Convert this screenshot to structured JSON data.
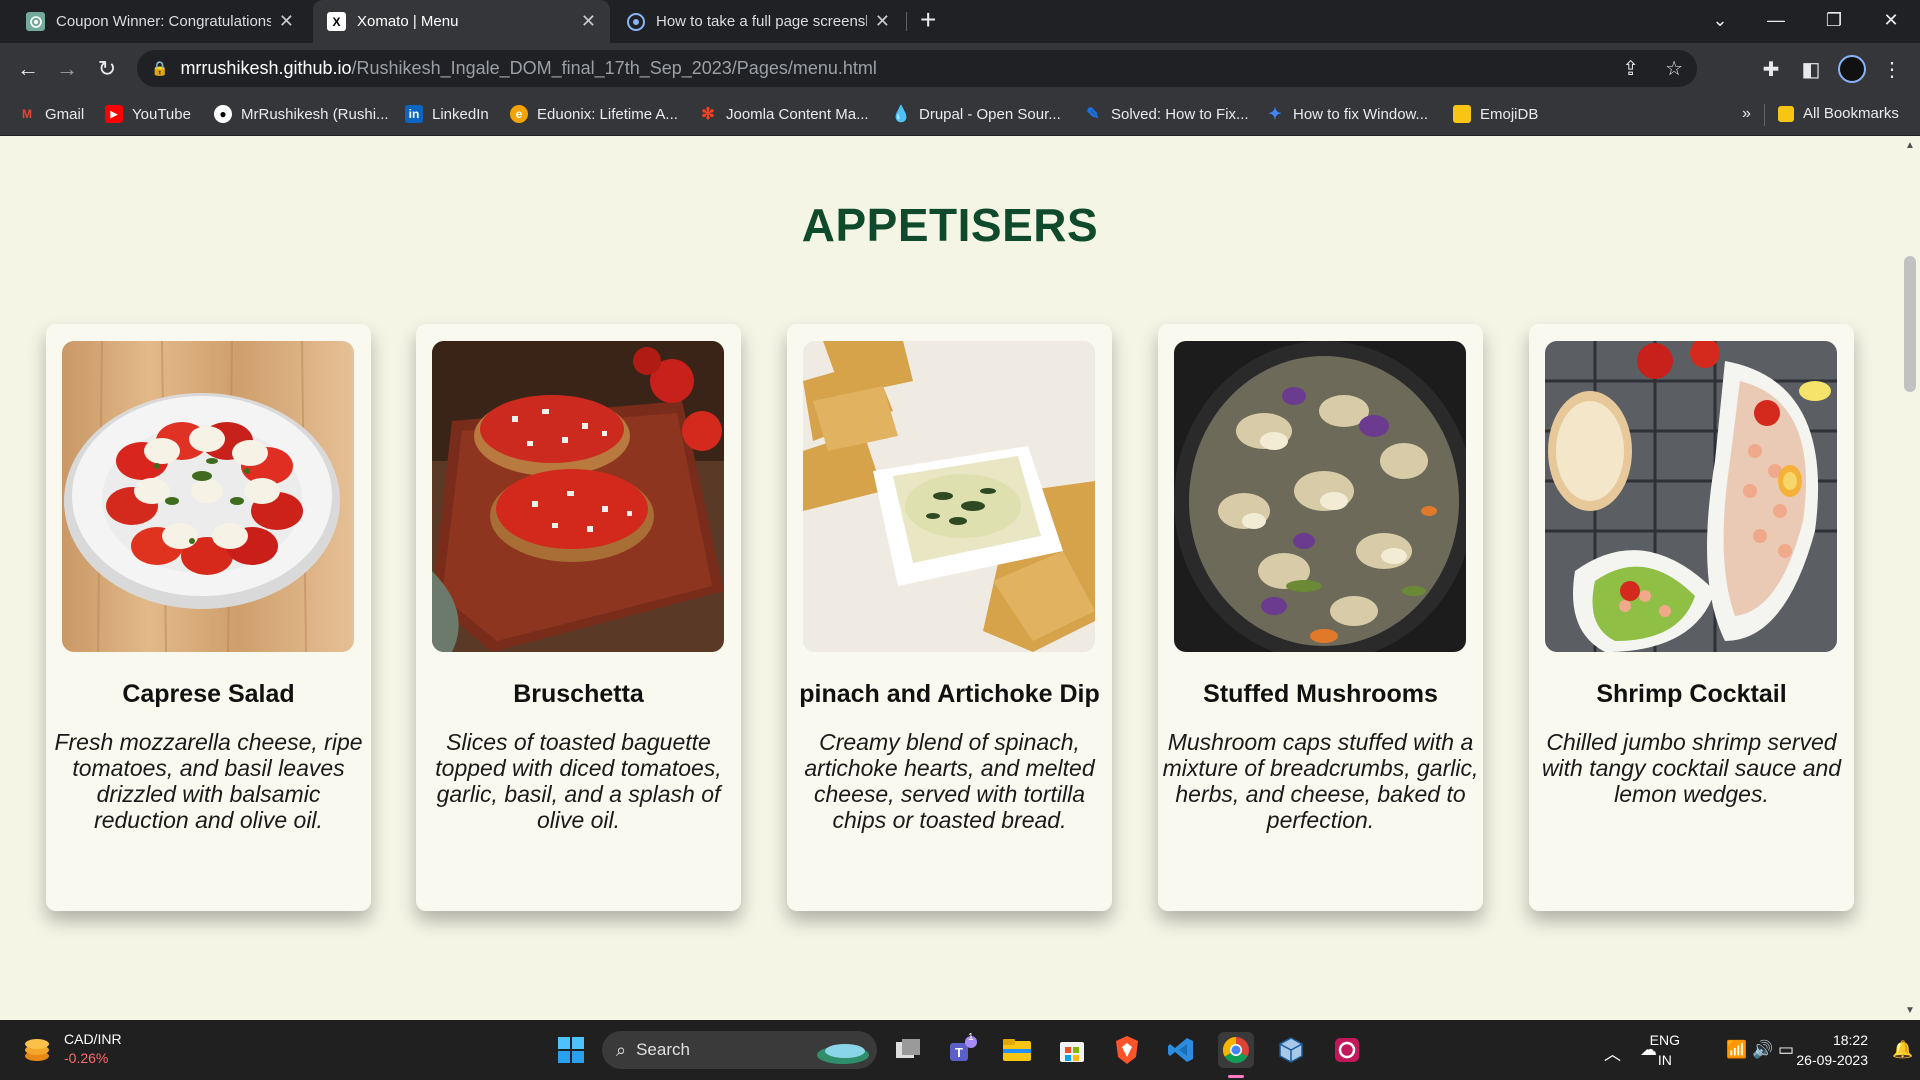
{
  "browser": {
    "tabs": [
      {
        "title": "Coupon Winner: Congratulations",
        "icon": "openai-icon",
        "active": false
      },
      {
        "title": "Xomato | Menu",
        "icon": "xomato-icon",
        "active": true
      },
      {
        "title": "How to take a full page screenshot",
        "icon": "chrome-icon",
        "active": false
      }
    ],
    "url_host": "mrrushikesh.github.io",
    "url_path": "/Rushikesh_Ingale_DOM_final_17th_Sep_2023/Pages/menu.html",
    "bookmarks": [
      {
        "label": "Gmail",
        "icon": "gmail-icon",
        "color": "#ea4335"
      },
      {
        "label": "YouTube",
        "icon": "youtube-icon",
        "color": "#ff0000"
      },
      {
        "label": "MrRushikesh (Rushi...",
        "icon": "github-icon",
        "color": "#ffffff"
      },
      {
        "label": "LinkedIn",
        "icon": "linkedin-icon",
        "color": "#0a66c2"
      },
      {
        "label": "Eduonix: Lifetime A...",
        "icon": "eduonix-icon",
        "color": "#f4a300"
      },
      {
        "label": "Joomla Content Ma...",
        "icon": "joomla-icon",
        "color": "#f44321"
      },
      {
        "label": "Drupal - Open Sour...",
        "icon": "drupal-icon",
        "color": "#0678be"
      },
      {
        "label": "Solved: How to Fix...",
        "icon": "solved-icon",
        "color": "#1a73e8"
      },
      {
        "label": "How to fix Window...",
        "icon": "sparkle-icon",
        "color": "#4285f4"
      },
      {
        "label": "EmojiDB",
        "icon": "folder-icon",
        "color": "#f9c513"
      }
    ],
    "overflow_label": "»",
    "all_bookmarks": "All Bookmarks"
  },
  "page": {
    "section_title": "APPETISERS",
    "colors": {
      "background": "#f5f5e6",
      "title": "#0e4a2b",
      "card": "#f9f9ef"
    },
    "items": [
      {
        "name": "Caprese Salad",
        "description": "Fresh mozzarella cheese, ripe tomatoes, and basil leaves drizzled with balsamic reduction and olive oil."
      },
      {
        "name": "Bruschetta",
        "description": "Slices of toasted baguette topped with diced tomatoes, garlic, basil, and a splash of olive oil."
      },
      {
        "name": "pinach and Artichoke Dip",
        "description": "Creamy blend of spinach, artichoke hearts, and melted cheese, served with tortilla chips or toasted bread."
      },
      {
        "name": "Stuffed Mushrooms",
        "description": "Mushroom caps stuffed with a mixture of breadcrumbs, garlic, herbs, and cheese, baked to perfection."
      },
      {
        "name": "Shrimp Cocktail",
        "description": "Chilled jumbo shrimp served with tangy cocktail sauce and lemon wedges."
      }
    ]
  },
  "taskbar": {
    "weather_title": "CAD/INR",
    "weather_change": "-0.26%",
    "search_label": "Search",
    "teams_badge": "1",
    "lang_top": "ENG",
    "lang_bottom": "IN",
    "time": "18:22",
    "date": "26-09-2023"
  }
}
